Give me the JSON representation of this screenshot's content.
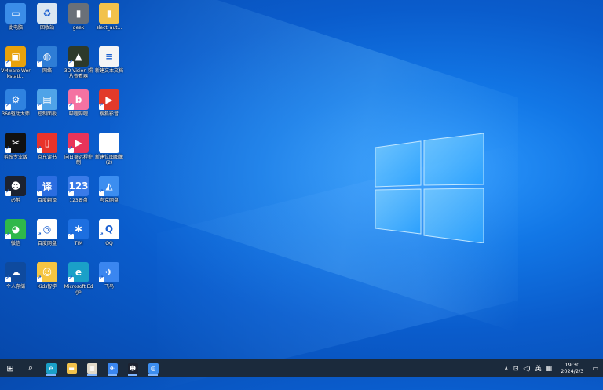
{
  "desktop": {
    "icons": [
      {
        "id": "this-pc",
        "label": "此电脑",
        "color": "#3b8de8",
        "glyph": "▭"
      },
      {
        "id": "recycle-bin",
        "label": "回收站",
        "color": "#d9e6f2",
        "glyph": "♻"
      },
      {
        "id": "geek",
        "label": "geek",
        "color": "#6a7078",
        "glyph": "▮"
      },
      {
        "id": "select-auto",
        "label": "slect_aut...",
        "color": "#f2c24b",
        "glyph": "▮"
      },
      {
        "id": "vmware",
        "label": "VMware Workstati...",
        "color": "#e8a20c",
        "glyph": "▣"
      },
      {
        "id": "network",
        "label": "网络",
        "color": "#2e7dd6",
        "glyph": "◍"
      },
      {
        "id": "3d-vision",
        "label": "3D Vision 照片查看器",
        "color": "#2d3a2a",
        "glyph": "▲"
      },
      {
        "id": "new-text-doc",
        "label": "新建文本文档",
        "color": "#f5f5f5",
        "glyph": "≡"
      },
      {
        "id": "360-driver",
        "label": "360驱动大师",
        "color": "#2f82e0",
        "glyph": "⚙"
      },
      {
        "id": "control-panel",
        "label": "控制面板",
        "color": "#4fa3e8",
        "glyph": "▤"
      },
      {
        "id": "bilibili",
        "label": "哔哩哔哩",
        "color": "#f472a2",
        "glyph": "b"
      },
      {
        "id": "sohu-video",
        "label": "搜狐影音",
        "color": "#e23a2a",
        "glyph": "▶"
      },
      {
        "id": "capcut",
        "label": "剪映专业版",
        "color": "#111111",
        "glyph": "✂"
      },
      {
        "id": "jd-reader",
        "label": "京东读书",
        "color": "#e8332a",
        "glyph": "▯"
      },
      {
        "id": "todesk",
        "label": "向日葵远程控制",
        "color": "#e8345a",
        "glyph": "▶"
      },
      {
        "id": "new-bmp",
        "label": "新建位图图像 (2)",
        "color": "#ffffff",
        "glyph": ""
      },
      {
        "id": "bijian",
        "label": "必剪",
        "color": "#1c2230",
        "glyph": "☻"
      },
      {
        "id": "baidu-translate",
        "label": "百度翻译",
        "color": "#2b6de0",
        "glyph": "译"
      },
      {
        "id": "123pan",
        "label": "123云盘",
        "color": "#3a7be8",
        "glyph": "123"
      },
      {
        "id": "aliyun-drive",
        "label": "夸克网盘",
        "color": "#3c8ef0",
        "glyph": "◭"
      },
      {
        "id": "wechat",
        "label": "微信",
        "color": "#2fb84a",
        "glyph": "◕"
      },
      {
        "id": "baidu-netdisk",
        "label": "百度网盘",
        "color": "#ffffff",
        "glyph": "◎"
      },
      {
        "id": "tim",
        "label": "TIM",
        "color": "#1d6fe0",
        "glyph": "✱"
      },
      {
        "id": "qq",
        "label": "QQ",
        "color": "#ffffff",
        "glyph": "Q"
      },
      {
        "id": "personal-cloud",
        "label": "个人存储",
        "color": "#0e4a9e",
        "glyph": "☁"
      },
      {
        "id": "kugou",
        "label": "Kids智学",
        "color": "#f5c542",
        "glyph": "☺"
      },
      {
        "id": "edge",
        "label": "Microsoft Edge",
        "color": "#1aa0c8",
        "glyph": "e"
      },
      {
        "id": "feishu",
        "label": "飞鸟",
        "color": "#3a86f0",
        "glyph": "✈"
      }
    ]
  },
  "taskbar": {
    "buttons": [
      {
        "id": "start",
        "glyph": "⊞",
        "color": "transparent"
      },
      {
        "id": "search",
        "glyph": "⌕",
        "color": "transparent"
      },
      {
        "id": "edge",
        "glyph": "e",
        "color": "#1aa0c8"
      },
      {
        "id": "file-explorer",
        "glyph": "▬",
        "color": "#f2c24b"
      },
      {
        "id": "store",
        "glyph": "▦",
        "color": "#e0d9c8"
      },
      {
        "id": "feishu",
        "glyph": "✈",
        "color": "#3a86f0"
      },
      {
        "id": "bijian",
        "glyph": "☻",
        "color": "#1c2230"
      },
      {
        "id": "baidu-netdisk",
        "glyph": "◎",
        "color": "#3c8ef0"
      }
    ],
    "tray": {
      "chevron": "∧",
      "network": "⊡",
      "volume": "◁)",
      "ime": "英",
      "keyboard": "▦",
      "time": "19:30",
      "date": "2024/2/3",
      "notification": "▭"
    }
  }
}
